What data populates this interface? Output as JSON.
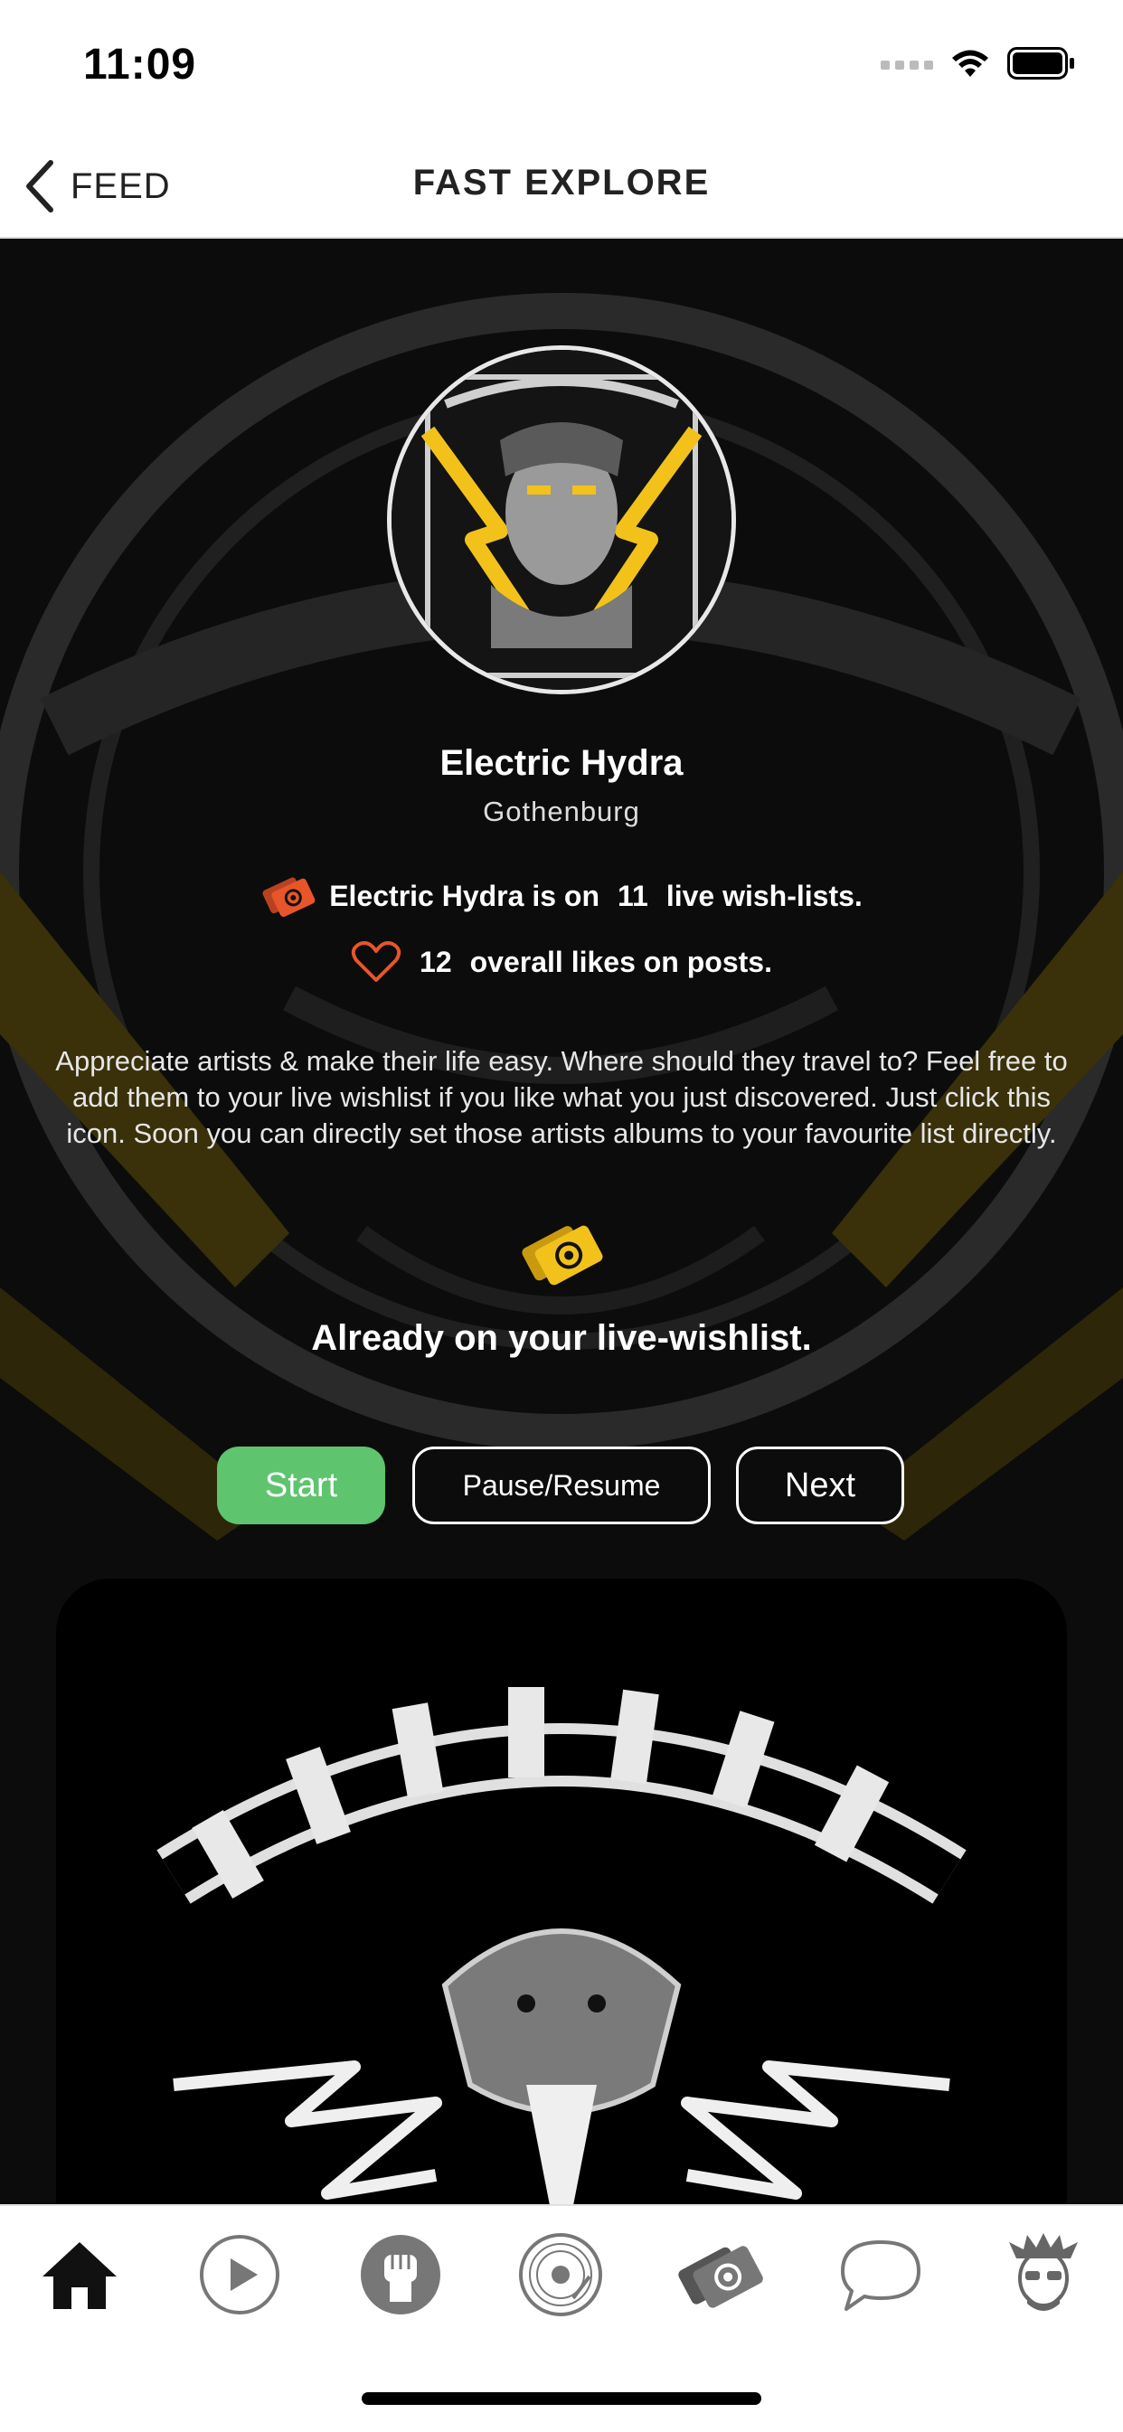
{
  "status_bar": {
    "time": "11:09"
  },
  "nav": {
    "back_label": "FEED",
    "title": "FAST EXPLORE"
  },
  "artist": {
    "name": "Electric Hydra",
    "city": "Gothenburg",
    "wishlist_prefix": "Electric Hydra is on",
    "wishlist_count": "11",
    "wishlist_suffix": "live wish-lists.",
    "likes_count": "12",
    "likes_suffix": "overall likes on posts."
  },
  "description": "Appreciate artists & make their life easy. Where should they travel to? Feel free to add them to your live wishlist if you like what you just discovered. Just click this icon. Soon you can directly set those artists albums to your favourite list directly.",
  "wishlist_status": "Already on your live-wishlist.",
  "controls": {
    "start": "Start",
    "pause": "Pause/Resume",
    "next": "Next"
  },
  "tabs": [
    {
      "icon": "home-icon",
      "active": true
    },
    {
      "icon": "play-icon",
      "active": false
    },
    {
      "icon": "fist-icon",
      "active": false
    },
    {
      "icon": "vinyl-icon",
      "active": false
    },
    {
      "icon": "tickets-icon",
      "active": false
    },
    {
      "icon": "chat-bubble-icon",
      "active": false
    },
    {
      "icon": "profile-avatar-icon",
      "active": false
    }
  ],
  "colors": {
    "accent_green": "#5ec46e",
    "ticket_orange": "#e8552a",
    "ticket_yellow": "#f2c21b",
    "heart_orange": "#e8552a"
  }
}
